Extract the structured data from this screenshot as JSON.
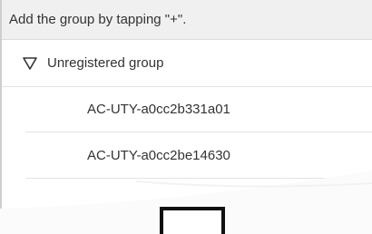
{
  "hint": {
    "text": "Add the group by tapping \"+\"."
  },
  "group": {
    "title": "Unregistered group",
    "expand_icon": "triangle-down-outline-icon"
  },
  "devices": [
    {
      "name": "AC-UTY-a0cc2b331a01"
    },
    {
      "name": "AC-UTY-a0cc2be14630"
    }
  ],
  "colors": {
    "hint_background": "#f0f0f0",
    "accent": "#e0332f",
    "divider": "#e3e3e3",
    "text": "#333333"
  }
}
